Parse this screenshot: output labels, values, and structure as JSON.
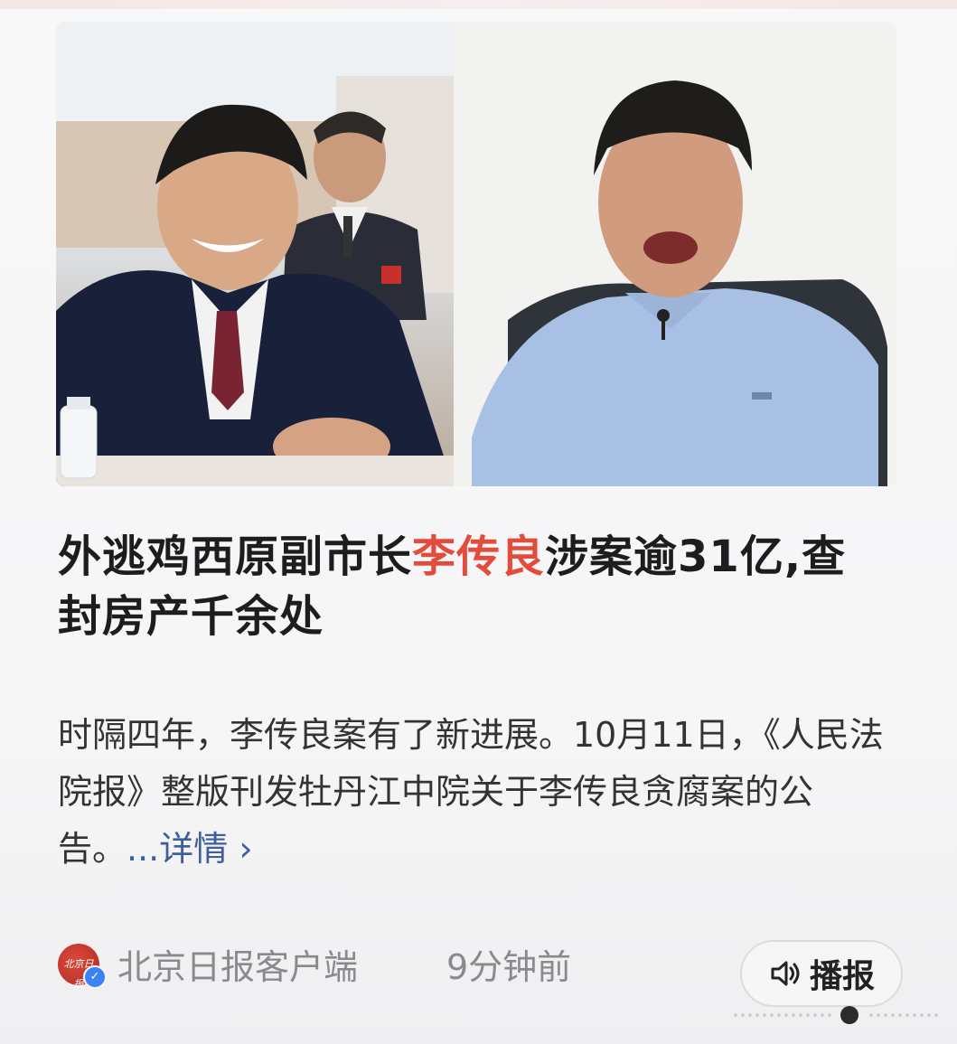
{
  "article": {
    "headline_pre": "外逃鸡西原副市长",
    "headline_name": "李传良",
    "headline_post": "涉案逾31亿,查封房产千余处",
    "summary": "时隔四年，李传良案有了新进展。10月11日，《人民法院报》整版刊发牡丹江中院关于李传良贪腐案的公告。",
    "more_prefix": "...",
    "more_label": "详情",
    "more_chevron": "›"
  },
  "source": {
    "name": "北京日报客户端",
    "time_ago": "9分钟前",
    "verified": true,
    "verified_icon": "check-badge-icon"
  },
  "actions": {
    "play_label": "播报",
    "play_icon": "speaker-icon"
  },
  "colors": {
    "highlight": "#e34b3a",
    "link": "#3d5f9a",
    "meta": "#8a8a8e"
  },
  "photos": {
    "left_alt": "photo-left",
    "right_alt": "photo-right"
  }
}
